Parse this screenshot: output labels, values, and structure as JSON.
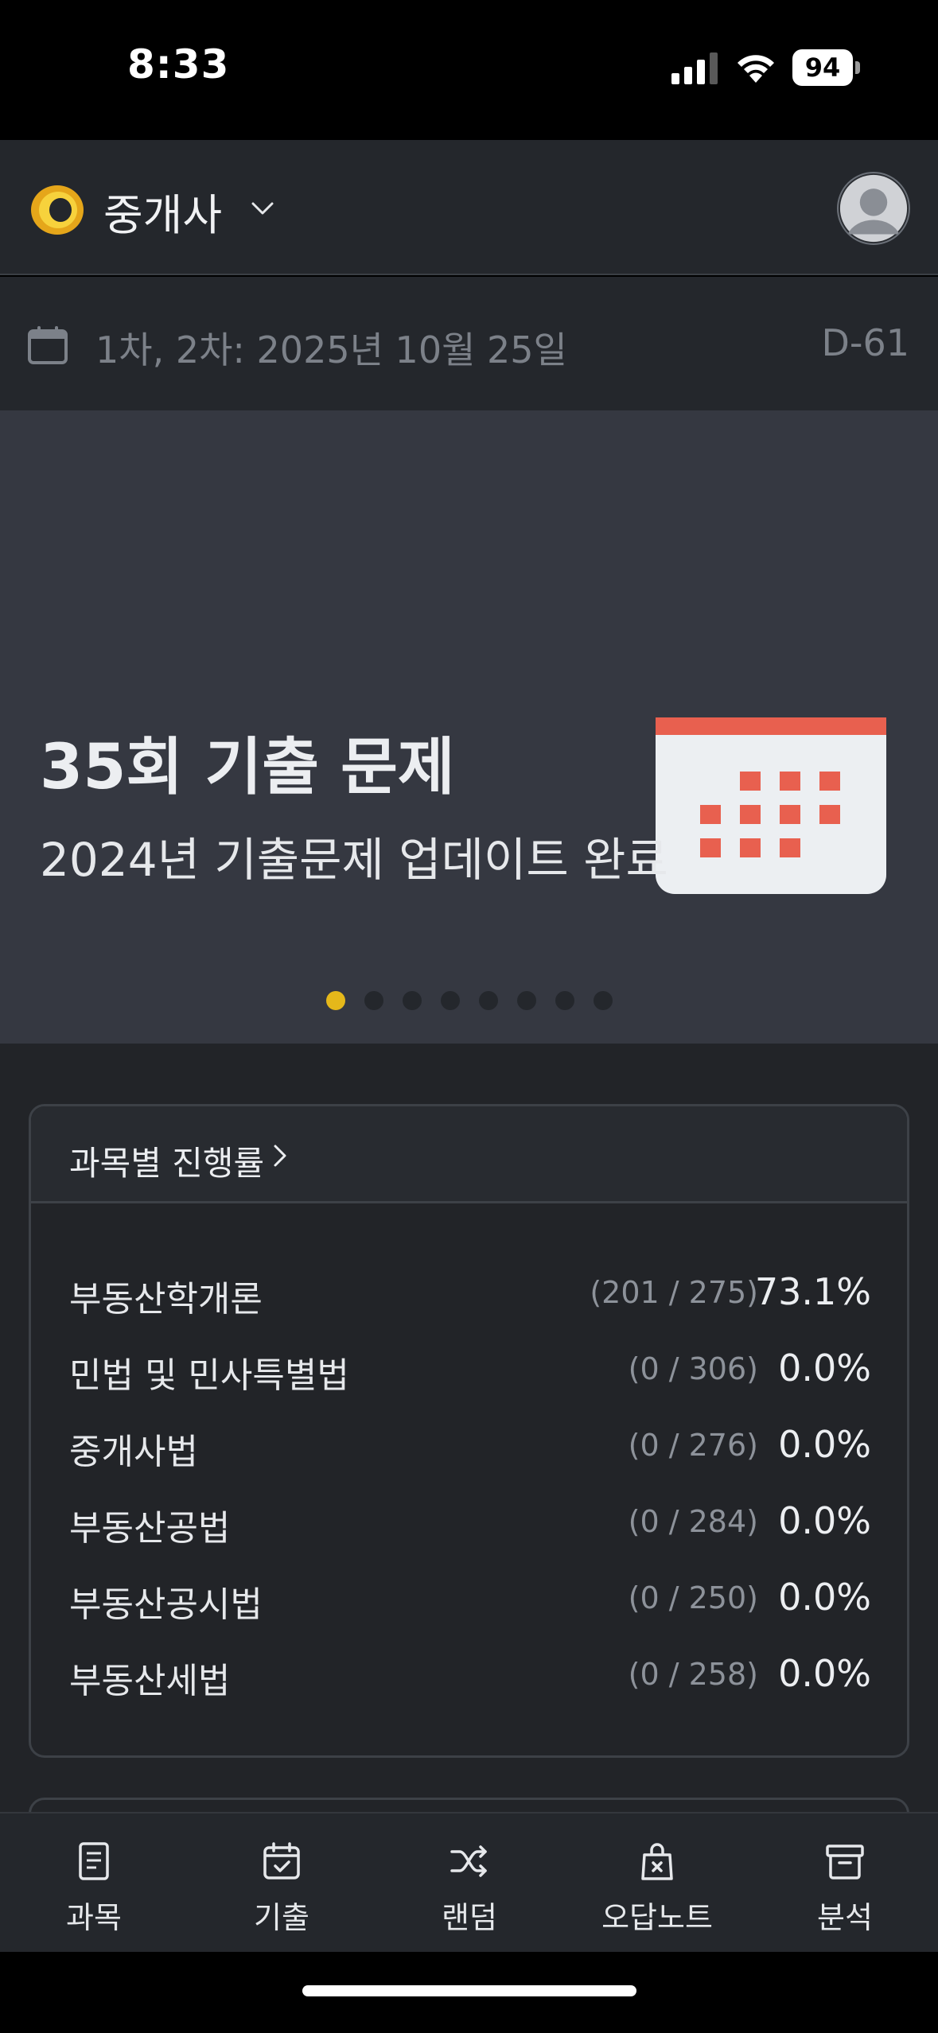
{
  "status_bar": {
    "time": "8:33",
    "battery": "94"
  },
  "header": {
    "title": "중개사"
  },
  "exam": {
    "date_text": "1차, 2차: 2025년 10월 25일",
    "dday": "D-61"
  },
  "banner": {
    "title": "35회 기출 문제",
    "subtitle": "2024년 기출문제 업데이트 완료",
    "slide_count": 8,
    "active_slide": 1,
    "accent_color": "#e5b81a",
    "icon_color": "#e8604f"
  },
  "progress": {
    "title": "과목별 진행률",
    "subjects": [
      {
        "name": "부동산학개론",
        "count": "(201 / 275)",
        "percent": "73.1%"
      },
      {
        "name": "민법 및 민사특별법",
        "count": "(0 / 306)",
        "percent": "0.0%"
      },
      {
        "name": "중개사법",
        "count": "(0 / 276)",
        "percent": "0.0%"
      },
      {
        "name": "부동산공법",
        "count": "(0 / 284)",
        "percent": "0.0%"
      },
      {
        "name": "부동산공시법",
        "count": "(0 / 250)",
        "percent": "0.0%"
      },
      {
        "name": "부동산세법",
        "count": "(0 / 258)",
        "percent": "0.0%"
      }
    ]
  },
  "tabs": [
    {
      "label": "과목",
      "icon": "document-icon"
    },
    {
      "label": "기출",
      "icon": "calendar-check-icon"
    },
    {
      "label": "랜덤",
      "icon": "shuffle-icon"
    },
    {
      "label": "오답노트",
      "icon": "wrong-answer-bag-icon"
    },
    {
      "label": "분석",
      "icon": "archive-icon"
    }
  ]
}
